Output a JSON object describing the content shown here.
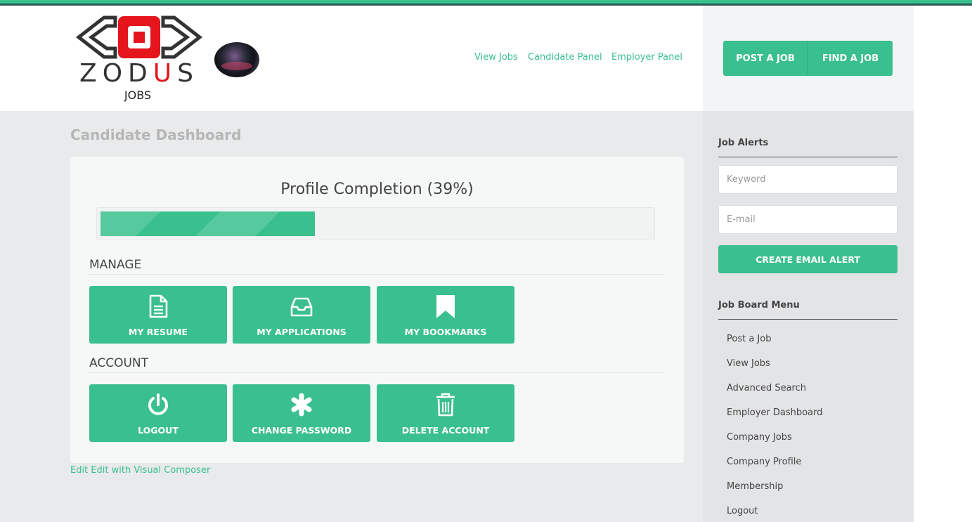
{
  "brand": {
    "logo_word_1": "ZOD",
    "logo_word_red": "U",
    "logo_word_2": "S",
    "logo_sub": "JOBS"
  },
  "nav": {
    "view_jobs": "View Jobs",
    "candidate_panel": "Candidate Panel",
    "employer_panel": "Employer Panel"
  },
  "header_buttons": {
    "post_job": "POST A JOB",
    "find_job": "FIND A JOB"
  },
  "page_title": "Candidate Dashboard",
  "profile": {
    "title": "Profile Completion (39%)",
    "completion": 0.39
  },
  "manage": {
    "heading": "MANAGE",
    "tiles": [
      {
        "label": "MY RESUME",
        "icon": "document-icon"
      },
      {
        "label": "MY APPLICATIONS",
        "icon": "inbox-icon"
      },
      {
        "label": "MY BOOKMARKS",
        "icon": "bookmark-icon"
      }
    ]
  },
  "account": {
    "heading": "ACCOUNT",
    "tiles": [
      {
        "label": "LOGOUT",
        "icon": "power-icon"
      },
      {
        "label": "CHANGE PASSWORD",
        "icon": "asterisk-icon"
      },
      {
        "label": "DELETE ACCOUNT",
        "icon": "trash-icon"
      }
    ]
  },
  "edit_link": "Edit Edit with Visual Composer",
  "sidebar": {
    "alerts_heading": "Job Alerts",
    "keyword_placeholder": "Keyword",
    "email_placeholder": "E-mail",
    "alert_button": "CREATE EMAIL ALERT",
    "menu_heading": "Job Board Menu",
    "menu": [
      "Post a Job",
      "View Jobs",
      "Advanced Search",
      "Employer Dashboard",
      "Company Jobs",
      "Company Profile",
      "Membership",
      "Logout"
    ]
  },
  "colors": {
    "accent": "#3abf8e",
    "logo_red": "#e4161b"
  }
}
